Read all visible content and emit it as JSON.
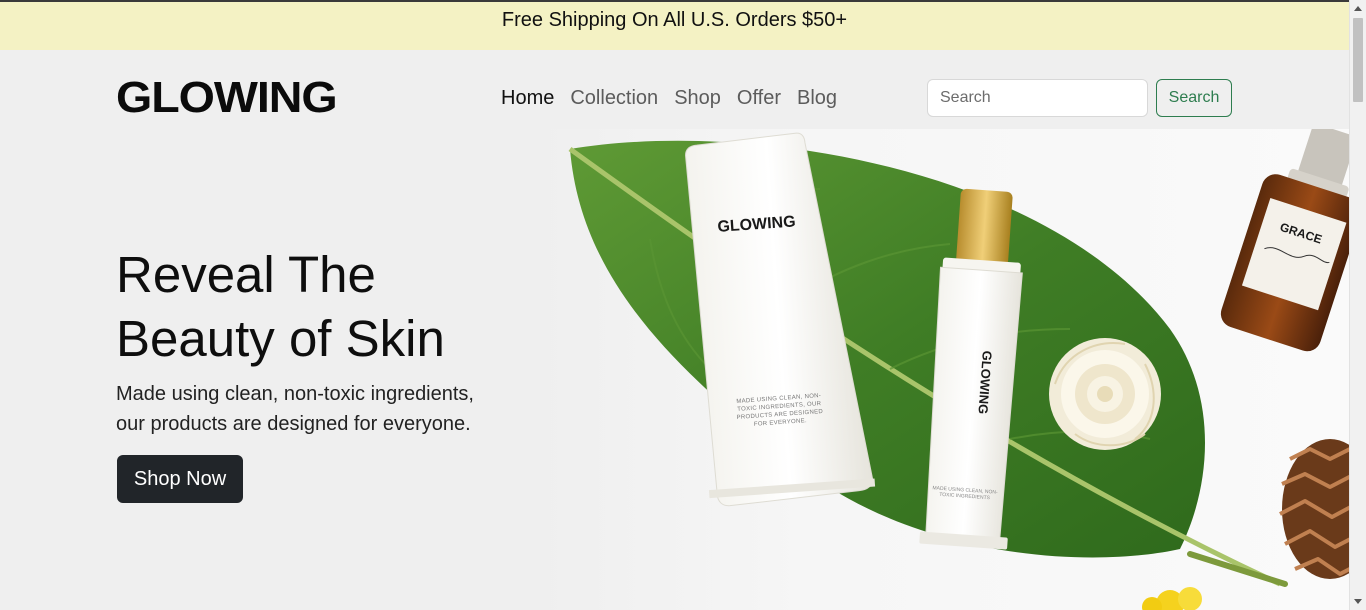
{
  "announcement": {
    "text": "Free Shipping On All U.S. Orders $50+"
  },
  "header": {
    "logo": "GLOWING",
    "nav": [
      {
        "label": "Home",
        "active": true
      },
      {
        "label": "Collection",
        "active": false
      },
      {
        "label": "Shop",
        "active": false
      },
      {
        "label": "Offer",
        "active": false
      },
      {
        "label": "Blog",
        "active": false
      }
    ],
    "search": {
      "placeholder": "Search",
      "value": "",
      "button_label": "Search"
    }
  },
  "hero": {
    "title": "Reveal The Beauty of Skin",
    "subtitle": "Made using clean, non-toxic ingredients, our products are designed for everyone.",
    "cta_label": "Shop Now",
    "image": {
      "tube_large_label": "GLOWING",
      "tube_large_text": "MADE USING CLEAN, NON-TOXIC INGREDIENTS, OUR PRODUCTS ARE DESIGNED FOR EVERYONE.",
      "tube_small_label": "GLOWING",
      "tube_small_text": "MADE USING CLEAN, NON-TOXIC INGREDIENTS",
      "bottle_label": "GRACE"
    }
  },
  "colors": {
    "announcement_bg": "#f4f2c4",
    "accent_green": "#2e7d4f",
    "cta_bg": "#212529",
    "leaf_green": "#3f7d25"
  }
}
